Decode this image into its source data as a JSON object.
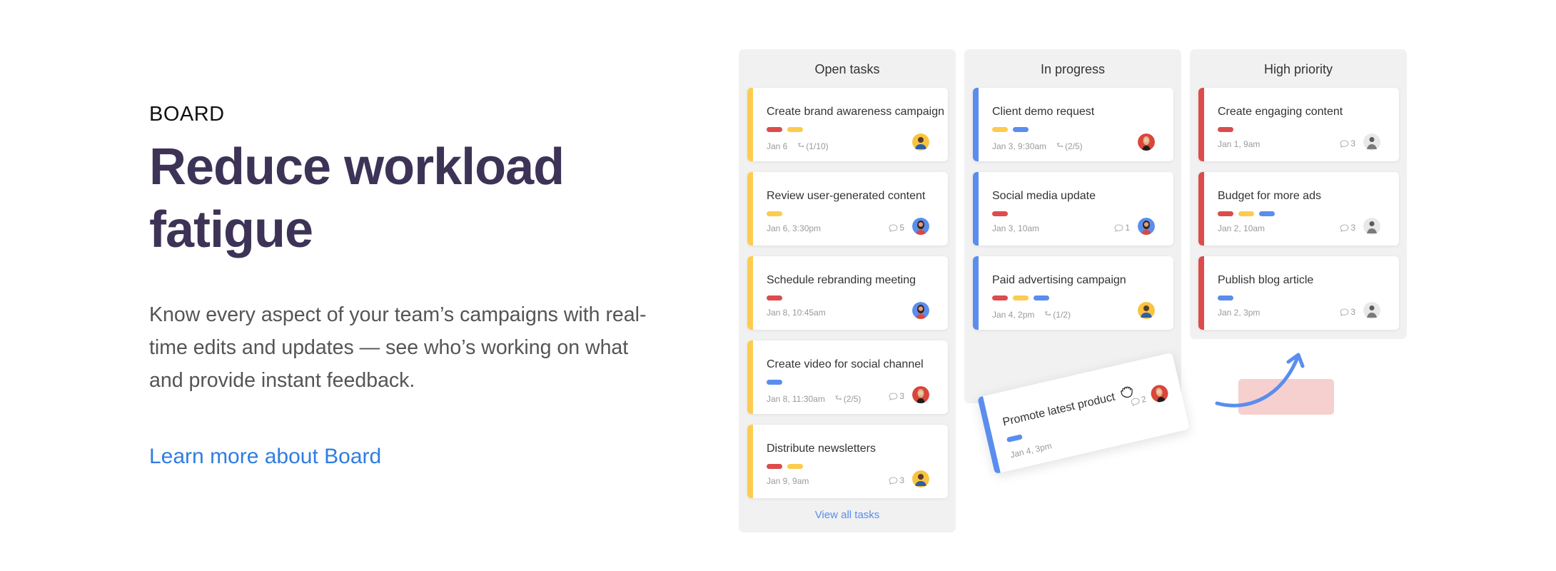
{
  "intro": {
    "eyebrow": "BOARD",
    "headline_line1": "Reduce workload",
    "headline_line2": "fatigue",
    "description": "Know every aspect of your team’s campaigns with real-time edits and updates — see who’s working on what and provide instant feedback.",
    "link_label": "Learn more about Board"
  },
  "colors": {
    "tag_red": "#dc4c4c",
    "tag_yellow": "#fdcb4f",
    "tag_blue": "#5a8dee",
    "headline": "#3d3356",
    "link": "#2f7de1",
    "drop_zone": "#f6cfcf"
  },
  "board": {
    "columns": [
      {
        "title": "Open tasks",
        "accent": "yellow",
        "footer_link": "View all tasks",
        "cards": [
          {
            "title": "Create brand awareness campaign",
            "tags": [
              "red",
              "yellow"
            ],
            "date": "Jan 6",
            "subtasks": "(1/10)",
            "comments": null,
            "avatar": "man-yellow"
          },
          {
            "title": "Review user-generated content",
            "tags": [
              "yellow"
            ],
            "date": "Jan 6, 3:30pm",
            "subtasks": null,
            "comments": "5",
            "avatar": "woman-blue"
          },
          {
            "title": "Schedule rebranding meeting",
            "tags": [
              "red"
            ],
            "date": "Jan 8, 10:45am",
            "subtasks": null,
            "comments": null,
            "avatar": "woman-blue"
          },
          {
            "title": "Create video for social channel",
            "tags": [
              "blue"
            ],
            "date": "Jan 8, 11:30am",
            "subtasks": "(2/5)",
            "comments": "3",
            "avatar": "woman-red"
          },
          {
            "title": "Distribute newsletters",
            "tags": [
              "red",
              "yellow"
            ],
            "date": "Jan 9, 9am",
            "subtasks": null,
            "comments": "3",
            "avatar": "man-yellow"
          }
        ]
      },
      {
        "title": "In progress",
        "accent": "blue",
        "cards": [
          {
            "title": "Client demo request",
            "tags": [
              "yellow",
              "blue"
            ],
            "date": "Jan 3, 9:30am",
            "subtasks": "(2/5)",
            "comments": null,
            "avatar": "woman-red"
          },
          {
            "title": "Social media update",
            "tags": [
              "red"
            ],
            "date": "Jan 3, 10am",
            "subtasks": null,
            "comments": "1",
            "avatar": "woman-blue"
          },
          {
            "title": "Paid advertising campaign",
            "tags": [
              "red",
              "yellow",
              "blue"
            ],
            "date": "Jan 4, 2pm",
            "subtasks": "(1/2)",
            "comments": null,
            "avatar": "man-yellow"
          }
        ]
      },
      {
        "title": "High priority",
        "accent": "red",
        "cards": [
          {
            "title": "Create engaging content",
            "tags": [
              "red"
            ],
            "date": "Jan 1, 9am",
            "subtasks": null,
            "comments": "3",
            "avatar": "man-gray"
          },
          {
            "title": "Budget for more ads",
            "tags": [
              "red",
              "yellow",
              "blue"
            ],
            "date": "Jan 2, 10am",
            "subtasks": null,
            "comments": "3",
            "avatar": "man-gray"
          },
          {
            "title": "Publish blog article",
            "tags": [
              "blue"
            ],
            "date": "Jan 2, 3pm",
            "subtasks": null,
            "comments": "3",
            "avatar": "man-gray"
          }
        ]
      }
    ],
    "dragged_card": {
      "title": "Promote latest product",
      "tags": [
        "blue"
      ],
      "date": "Jan 4, 3pm",
      "comments": "2",
      "avatar": "woman-red",
      "accent": "blue"
    }
  }
}
